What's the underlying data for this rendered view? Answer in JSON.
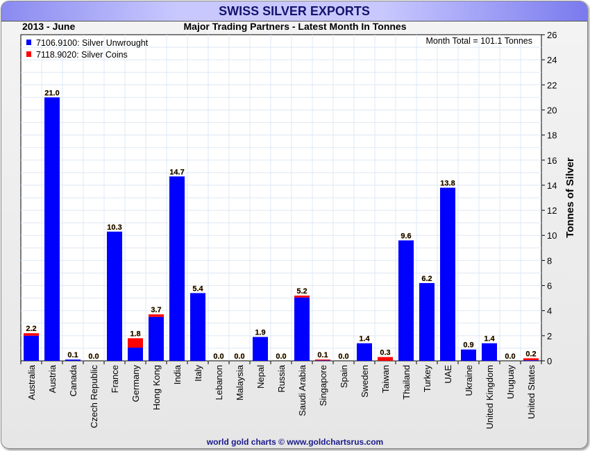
{
  "chart_data": {
    "type": "bar",
    "stacked": true,
    "title": "SWISS SILVER EXPORTS",
    "subtitle": "Major Trading Partners - Latest Month In Tonnes",
    "period": "2013 - June",
    "annotation": "Month Total = 101.1 Tonnes",
    "ylabel": "Tonnes of Silver",
    "xlabel": "",
    "ylim": [
      0,
      26
    ],
    "yticks": [
      0,
      2,
      4,
      6,
      8,
      10,
      12,
      14,
      16,
      18,
      20,
      22,
      24,
      26
    ],
    "grid": true,
    "legend_position": "top-left",
    "categories": [
      "Australia",
      "Austria",
      "Canada",
      "Czech Republic",
      "France",
      "Germany",
      "Hong Kong",
      "India",
      "Italy",
      "Lebanon",
      "Malaysia",
      "Nepal",
      "Russia",
      "Saudi Arabia",
      "Singapore",
      "Spain",
      "Sweden",
      "Taiwan",
      "Thailand",
      "Turkey",
      "UAE",
      "Ukraine",
      "United Kingdom",
      "Uruguay",
      "United States"
    ],
    "series": [
      {
        "name": "7106.9100: Silver Unwrought",
        "color": "#0000ff",
        "values": [
          2.0,
          21.0,
          0.1,
          0.0,
          10.3,
          1.05,
          3.5,
          14.7,
          5.4,
          0.0,
          0.0,
          1.9,
          0.0,
          5.05,
          0.03,
          0.0,
          1.4,
          0.0,
          9.6,
          6.2,
          13.8,
          0.9,
          1.4,
          0.0,
          0.05
        ]
      },
      {
        "name": "7118.9020: Silver Coins",
        "color": "#ff0000",
        "values": [
          0.2,
          0.0,
          0.0,
          0.0,
          0.0,
          0.75,
          0.2,
          0.0,
          0.0,
          0.0,
          0.0,
          0.0,
          0.0,
          0.15,
          0.07,
          0.0,
          0.0,
          0.3,
          0.0,
          0.0,
          0.0,
          0.0,
          0.0,
          0.0,
          0.15
        ]
      }
    ],
    "totals_labels": [
      "2.2",
      "21.0",
      "0.1",
      "0.0",
      "10.3",
      "1.8",
      "3.7",
      "14.7",
      "5.4",
      "0.0",
      "0.0",
      "1.9",
      "0.0",
      "5.2",
      "0.1",
      "0.0",
      "1.4",
      "0.3",
      "9.6",
      "6.2",
      "13.8",
      "0.9",
      "1.4",
      "0.0",
      "0.2"
    ]
  },
  "footer": "world gold charts © www.goldchartsrus.com"
}
